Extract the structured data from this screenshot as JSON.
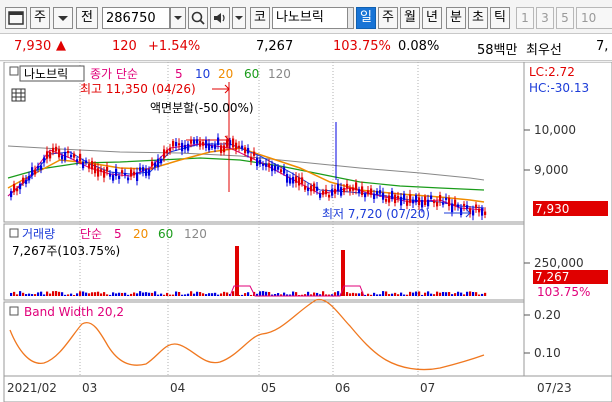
{
  "toolbar": {
    "period_label": "주",
    "prev_label": "전",
    "stock_code": "286750",
    "market_label": "코",
    "stock_name": "나노브릭",
    "timeframes": [
      "일",
      "주",
      "월",
      "년",
      "분",
      "초",
      "틱"
    ],
    "selected_timeframe": "일",
    "minute_options": [
      "1",
      "3",
      "5",
      "10"
    ]
  },
  "quote": {
    "price": "7,930",
    "change": "120",
    "change_pct": "+1.54%",
    "volume": "7,267",
    "volume_ratio": "103.75%",
    "turnover_rate": "0.08%",
    "trade_value": "58백만",
    "best_bid_label": "최우선",
    "best_bid_cut": "7,"
  },
  "price_panel": {
    "tab_name": "나노브릭",
    "ma_label": "종가 단순",
    "ma_periods": [
      "5",
      "10",
      "20",
      "60",
      "120"
    ],
    "lc_label": "LC:2.72",
    "hc_label": "HC:-30.13",
    "high_annotation": "최고 11,350 (04/26)",
    "low_annotation": "최저 7,720 (07/20)",
    "split_annotation": "액면분할(-50.00%)",
    "current_price_tag": "7,930",
    "axis_ticks": [
      "10,000",
      "9,000"
    ]
  },
  "volume_panel": {
    "title": "거래량",
    "ma_label": "단순",
    "ma_periods": [
      "5",
      "20",
      "60",
      "120"
    ],
    "volume_info": "7,267주(103.75%)",
    "axis_tick": "250,000",
    "volume_tag": "7,267",
    "ratio_tag": "103.75%"
  },
  "bandwidth_panel": {
    "title": "Band Width 20,2",
    "axis_ticks": [
      "0.20",
      "0.10"
    ]
  },
  "date_axis": {
    "labels": [
      "2021/02",
      "03",
      "04",
      "05",
      "06",
      "07"
    ],
    "end_label": "07/23"
  },
  "colors": {
    "candle_up": "#e00000",
    "candle_down": "#0000e0",
    "ma5": "#e0007a",
    "ma10": "#1c3cd8",
    "ma20": "#f08c00",
    "ma60": "#1a9c1a",
    "ma120": "#888888",
    "bandwidth": "#f07820",
    "selected_tab": "#1874d6"
  }
}
